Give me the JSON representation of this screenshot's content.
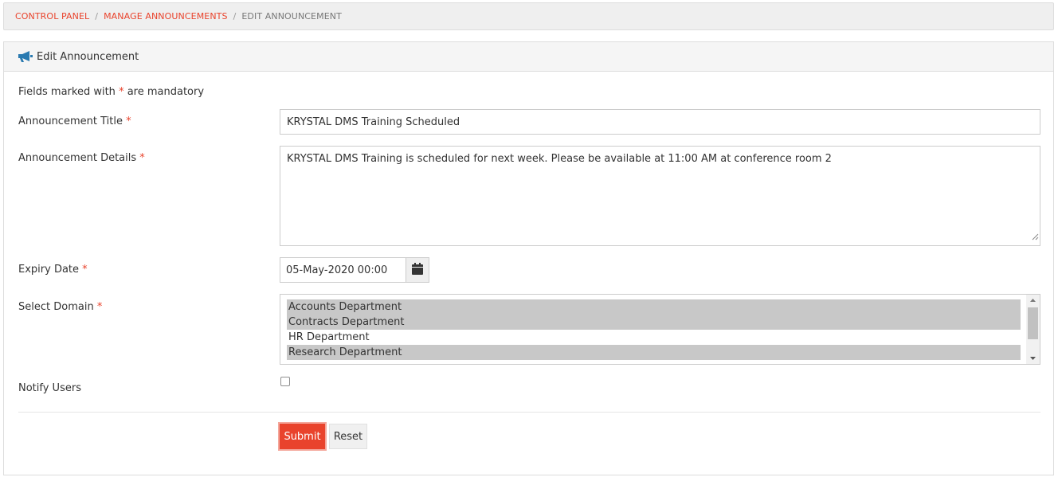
{
  "breadcrumb": {
    "items": [
      "CONTROL PANEL",
      "MANAGE ANNOUNCEMENTS"
    ],
    "current": "EDIT ANNOUNCEMENT",
    "separator": "/"
  },
  "panel": {
    "title": "Edit Announcement",
    "icon": "bullhorn-icon"
  },
  "form": {
    "mandatory_note_prefix": "Fields marked with",
    "mandatory_note_star": "*",
    "mandatory_note_suffix": "are mandatory",
    "title_label": "Announcement Title",
    "title_value": "KRYSTAL DMS Training Scheduled",
    "details_label": "Announcement Details",
    "details_value": "KRYSTAL DMS Training is scheduled for next week. Please be available at 11:00 AM at conference room 2",
    "expiry_label": "Expiry Date",
    "expiry_value": "05-May-2020 00:00",
    "domain_label": "Select Domain",
    "domain_options": [
      {
        "label": "Accounts Department",
        "selected": true
      },
      {
        "label": "Contracts Department",
        "selected": true
      },
      {
        "label": "HR Department",
        "selected": false
      },
      {
        "label": "Research Department",
        "selected": true
      }
    ],
    "notify_label": "Notify Users",
    "notify_checked": false,
    "required_mark": "*"
  },
  "buttons": {
    "submit": "Submit",
    "reset": "Reset"
  },
  "colors": {
    "accent": "#e9432c",
    "icon_blue": "#2a7ab0"
  }
}
